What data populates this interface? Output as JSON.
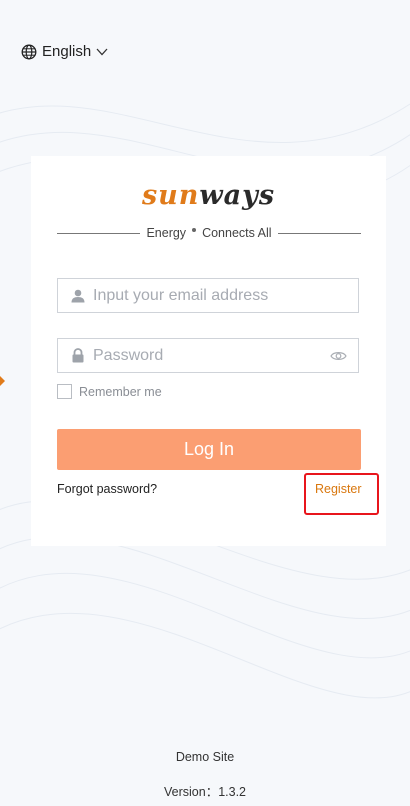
{
  "language": {
    "label": "English"
  },
  "brand": {
    "part1": "sun",
    "part2": "ways",
    "tag_word1": "Energy",
    "tag_word2": "Connects All"
  },
  "form": {
    "email_placeholder": "Input your email address",
    "password_placeholder": "Password",
    "remember_label": "Remember me",
    "login_label": "Log In",
    "forgot_label": "Forgot password?",
    "register_label": "Register"
  },
  "footer": {
    "site": "Demo Site",
    "version": "Version：1.3.2"
  },
  "colors": {
    "accent": "#e07b1a",
    "button": "#fb9e72",
    "highlight": "#e8151c"
  },
  "icons": [
    "globe-icon",
    "chevron-down-icon",
    "user-icon",
    "lock-icon",
    "eye-icon"
  ]
}
